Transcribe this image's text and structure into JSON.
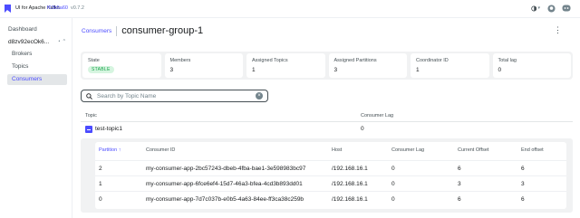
{
  "header": {
    "app_title": "UI for Apache Kafka",
    "commit": "f63b5a60",
    "version": "v0.7.2"
  },
  "sidebar": {
    "dashboard": "Dashboard",
    "cluster": "d8zv92ecOk6...",
    "items": [
      {
        "label": "Brokers"
      },
      {
        "label": "Topics"
      },
      {
        "label": "Consumers"
      }
    ]
  },
  "breadcrumb": {
    "parent": "Consumers",
    "title": "consumer-group-1"
  },
  "stats": [
    {
      "label": "State",
      "value": "STABLE"
    },
    {
      "label": "Members",
      "value": "3"
    },
    {
      "label": "Assigned Topics",
      "value": "1"
    },
    {
      "label": "Assigned Partitions",
      "value": "3"
    },
    {
      "label": "Coordinator ID",
      "value": "1"
    },
    {
      "label": "Total lag",
      "value": "0"
    }
  ],
  "search": {
    "placeholder": "Search by Topic Name",
    "value": ""
  },
  "topics_table": {
    "headers": [
      "Topic",
      "Consumer Lag"
    ],
    "rows": [
      {
        "topic": "test-topic1",
        "lag": "0"
      }
    ]
  },
  "partitions_table": {
    "headers": [
      "Partition",
      "Consumer ID",
      "Host",
      "Consumer Lag",
      "Current Offset",
      "End offset"
    ],
    "sorted_column_indicator": "↑",
    "rows": [
      {
        "partition": "2",
        "consumer_id": "my-consumer-app-2bc57243-dbeb-4fba-bae1-3e598983bc97",
        "host": "/192.168.16.1",
        "lag": "0",
        "current_offset": "6",
        "end_offset": "6"
      },
      {
        "partition": "1",
        "consumer_id": "my-consumer-app-6fce6ef4-15d7-46a3-bfea-4cd3b893dd01",
        "host": "/192.168.16.1",
        "lag": "0",
        "current_offset": "3",
        "end_offset": "3"
      },
      {
        "partition": "0",
        "consumer_id": "my-consumer-app-7d7c037b-e0b5-4a63-84ee-ff3ca38c259b",
        "host": "/192.168.16.1",
        "lag": "0",
        "current_offset": "6",
        "end_offset": "6"
      }
    ]
  },
  "colors": {
    "accent": "#4c4cff",
    "stable_badge_bg": "#d6f5e0",
    "stable_badge_text": "#17a34a"
  },
  "icons": {
    "logo": "kafka-logo-icon",
    "theme": "theme-toggle-icon",
    "github": "github-icon",
    "discord": "discord-icon",
    "search": "search-icon",
    "clear": "clear-icon",
    "kebab": "kebab-menu-icon",
    "expand": "collapse-icon"
  }
}
